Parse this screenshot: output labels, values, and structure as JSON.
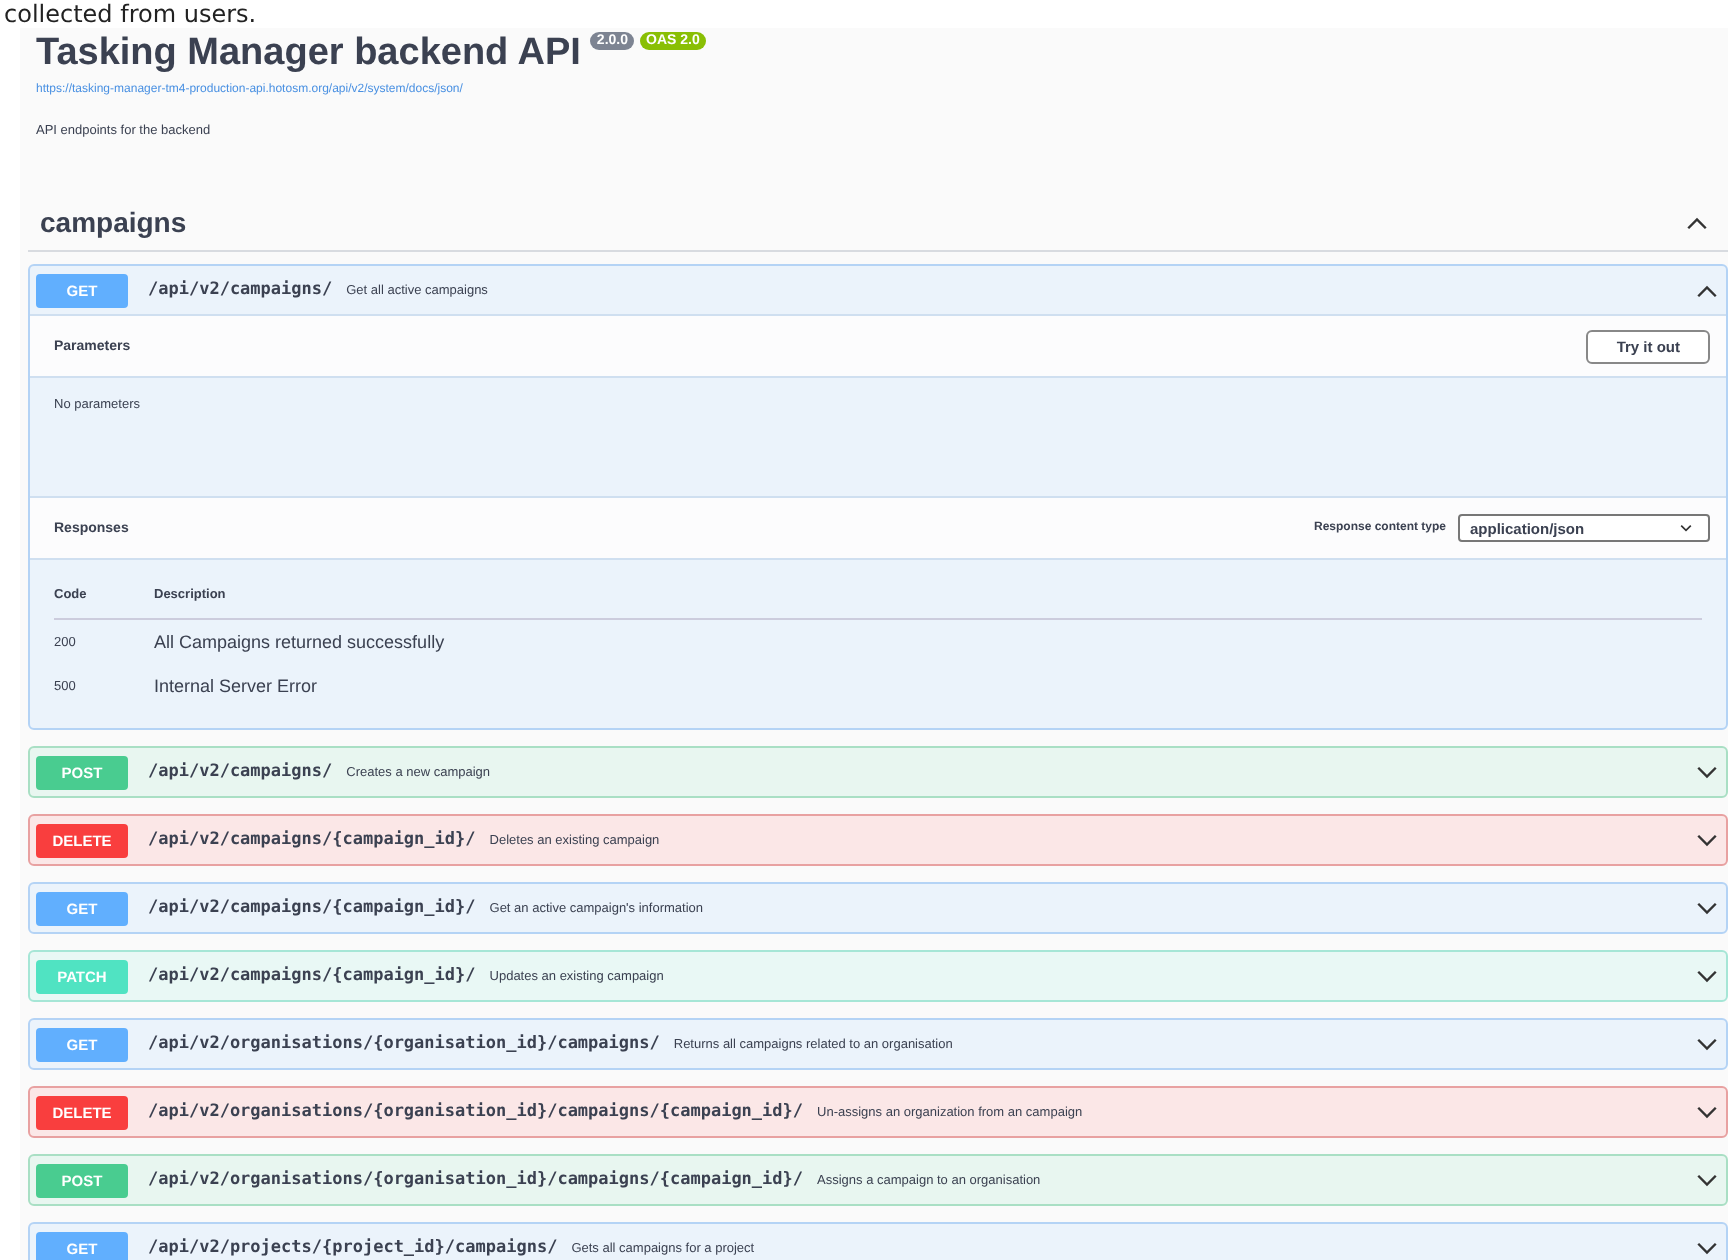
{
  "top_text": "collected from users.",
  "info": {
    "title": "Tasking Manager backend API",
    "badges": [
      {
        "label": "2.0.0",
        "kind": "version"
      },
      {
        "label": "OAS 2.0",
        "kind": "spec"
      }
    ],
    "link": "https://tasking-manager-tm4-production-api.hotosm.org/api/v2/system/docs/json/",
    "description": "API endpoints for the backend"
  },
  "section": {
    "title": "campaigns",
    "expanded": true
  },
  "operations": [
    {
      "method": "GET",
      "path": "/api/v2/campaigns/",
      "summary": "Get all active campaigns",
      "expanded": true,
      "details": {
        "parameters_title": "Parameters",
        "try_button": "Try it out",
        "no_parameters": "No parameters",
        "responses_title": "Responses",
        "content_type_label": "Response content type",
        "content_type": "application/json",
        "columns": [
          "Code",
          "Description"
        ],
        "responses": [
          {
            "code": "200",
            "description": "All Campaigns returned successfully"
          },
          {
            "code": "500",
            "description": "Internal Server Error"
          }
        ]
      }
    },
    {
      "method": "POST",
      "path": "/api/v2/campaigns/",
      "summary": "Creates a new campaign",
      "expanded": false
    },
    {
      "method": "DELETE",
      "path": "/api/v2/campaigns/{campaign_id}/",
      "summary": "Deletes an existing campaign",
      "expanded": false
    },
    {
      "method": "GET",
      "path": "/api/v2/campaigns/{campaign_id}/",
      "summary": "Get an active campaign's information",
      "expanded": false
    },
    {
      "method": "PATCH",
      "path": "/api/v2/campaigns/{campaign_id}/",
      "summary": "Updates an existing campaign",
      "expanded": false
    },
    {
      "method": "GET",
      "path": "/api/v2/organisations/{organisation_id}/campaigns/",
      "summary": "Returns all campaigns related to an organisation",
      "expanded": false
    },
    {
      "method": "DELETE",
      "path": "/api/v2/organisations/{organisation_id}/campaigns/{campaign_id}/",
      "summary": "Un-assigns an organization from an campaign",
      "expanded": false
    },
    {
      "method": "POST",
      "path": "/api/v2/organisations/{organisation_id}/campaigns/{campaign_id}/",
      "summary": "Assigns a campaign to an organisation",
      "expanded": false
    },
    {
      "method": "GET",
      "path": "/api/v2/projects/{project_id}/campaigns/",
      "summary": "Gets all campaigns for a project",
      "expanded": false
    }
  ]
}
